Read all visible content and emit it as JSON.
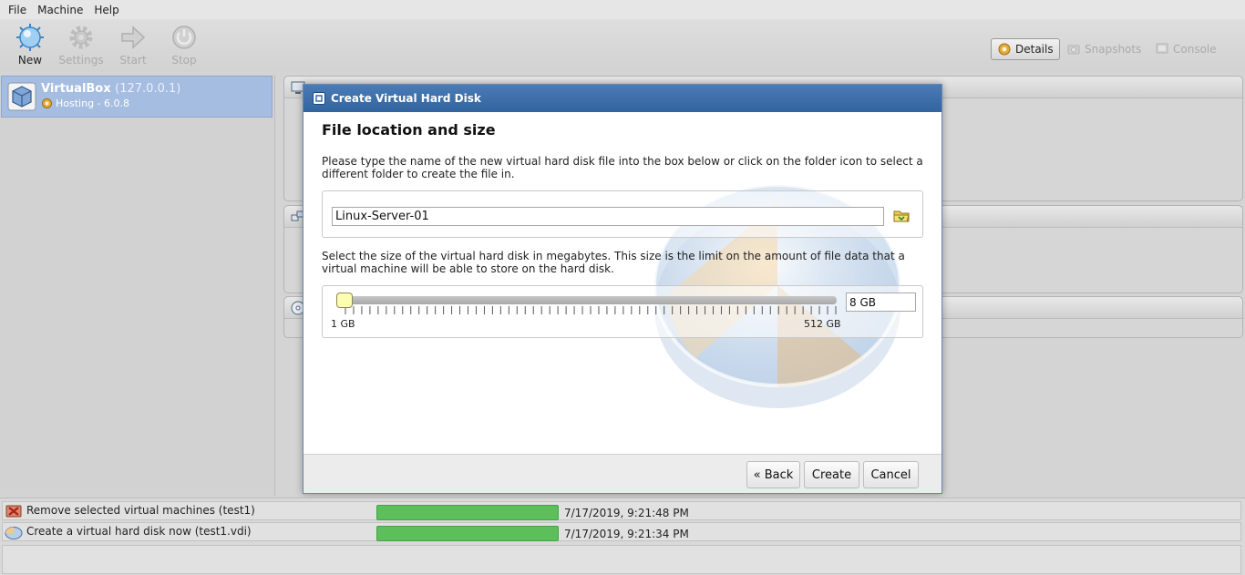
{
  "menu": [
    "File",
    "Machine",
    "Help"
  ],
  "toolbar": {
    "new_label": "New",
    "settings_label": "Settings",
    "start_label": "Start",
    "stop_label": "Stop",
    "details_label": "Details",
    "snapshots_label": "Snapshots",
    "console_label": "Console"
  },
  "vm": {
    "name": "VirtualBox",
    "host": "(127.0.0.1)",
    "status": "Hosting - 6.0.8"
  },
  "dialog": {
    "title": "Create Virtual Hard Disk",
    "heading": "File location and size",
    "location_description": "Please type the name of the new virtual hard disk file into the box below or click on the folder icon to select a different folder to create the file in.",
    "file_name": "Linux-Server-01",
    "size_description": "Select the size of the virtual hard disk in megabytes. This size is the limit on the amount of file data that a virtual machine will be able to store on the hard disk.",
    "size_value": "8 GB",
    "min_label": "1 GB",
    "max_label": "512 GB",
    "back_label": "« Back",
    "create_label": "Create",
    "cancel_label": "Cancel"
  },
  "tasks": [
    {
      "text": "Remove selected virtual machines (test1)",
      "progress": 1.0,
      "time": "7/17/2019, 9:21:48 PM"
    },
    {
      "text": "Create a virtual hard disk now (test1.vdi)",
      "progress": 1.0,
      "time": "7/17/2019, 9:21:34 PM"
    }
  ],
  "colors": {
    "selection": "#a5bde0",
    "dialog_title": "#3a6ca8",
    "progress": "#5cbf5c",
    "slider_thumb": "#fdfdb0"
  }
}
